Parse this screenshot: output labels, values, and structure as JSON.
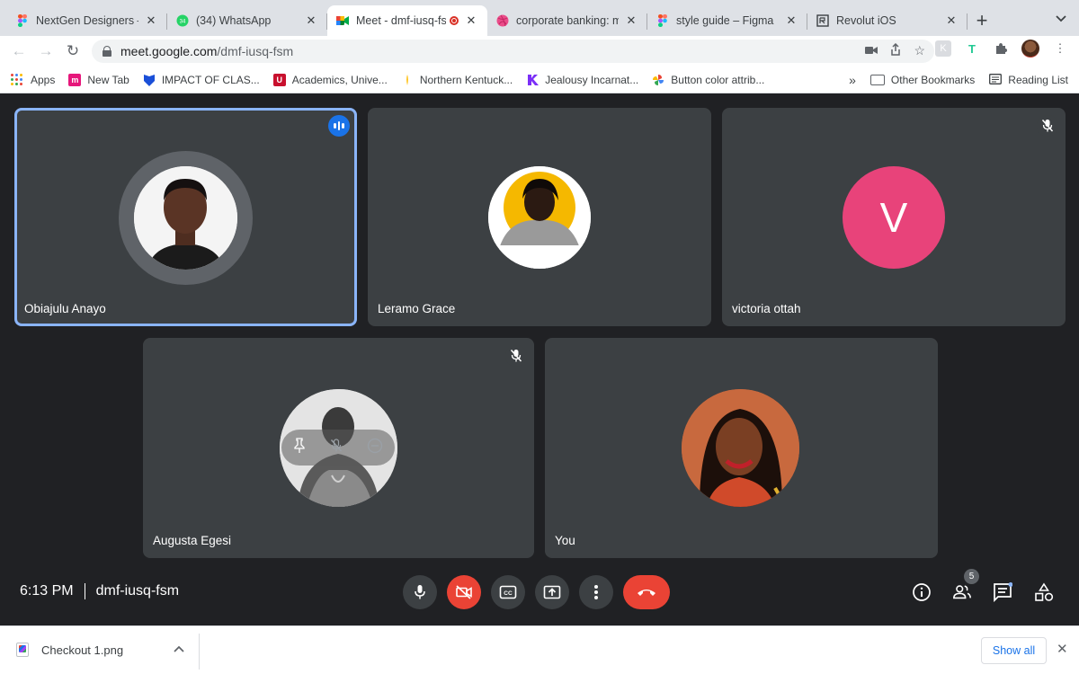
{
  "browser": {
    "tabs": [
      {
        "title": "NextGen Designers – F",
        "icon": "figma-icon",
        "active": false
      },
      {
        "title": "(34) WhatsApp",
        "icon": "whatsapp-icon",
        "active": false
      },
      {
        "title": "Meet - dmf-iusq-fs",
        "icon": "google-meet-icon",
        "active": true,
        "recording": true
      },
      {
        "title": "corporate banking: mo",
        "icon": "dribbble-icon",
        "active": false
      },
      {
        "title": "style guide – Figma",
        "icon": "figma-icon",
        "active": false
      },
      {
        "title": "Revolut iOS",
        "icon": "revolut-icon",
        "active": false
      }
    ],
    "new_tab_label": "+",
    "tab_menu_icon": "chevron-down-icon",
    "address": {
      "host": "meet.google.com",
      "path": "/dmf-iusq-fsm"
    },
    "bookmarks": [
      {
        "label": "Apps",
        "icon": "apps-grid-icon"
      },
      {
        "label": "New Tab",
        "icon": "new-tab-icon"
      },
      {
        "label": "IMPACT OF CLAS...",
        "icon": "shield-bookmark-icon"
      },
      {
        "label": "Academics, Unive...",
        "icon": "university-icon"
      },
      {
        "label": "Northern Kentuck...",
        "icon": "nku-icon"
      },
      {
        "label": "Jealousy Incarnat...",
        "icon": "k-logo-icon"
      },
      {
        "label": "Button color attrib...",
        "icon": "pinwheel-icon"
      }
    ],
    "bookmarks_overflow": "»",
    "other_bookmarks": "Other Bookmarks",
    "reading_list": "Reading List"
  },
  "meeting": {
    "participants": [
      {
        "name": "Obiajulu Anayo",
        "speaking": true,
        "muted": false
      },
      {
        "name": "Leramo Grace",
        "speaking": false,
        "muted": false
      },
      {
        "name": "victoria ottah",
        "speaking": false,
        "muted": true,
        "initial": "V"
      },
      {
        "name": "Augusta Egesi",
        "speaking": false,
        "muted": true
      },
      {
        "name": "You",
        "speaking": false,
        "muted": false
      }
    ],
    "time": "6:13 PM",
    "code": "dmf-iusq-fsm",
    "participant_count": "5",
    "colors": {
      "background": "#202124",
      "tile": "#3c4043",
      "danger": "#ea4335",
      "speaking_border": "#8ab4f8",
      "avatar_v": "#e8437a"
    }
  },
  "downloads": {
    "file": "Checkout 1.png",
    "show_all": "Show all"
  }
}
